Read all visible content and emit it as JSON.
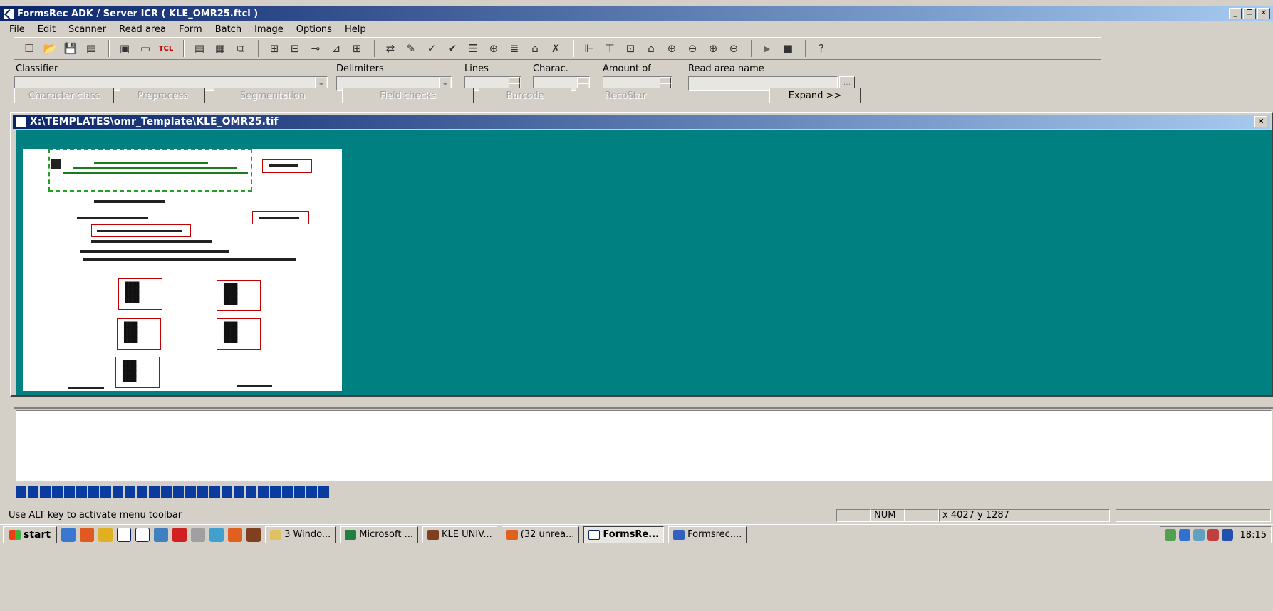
{
  "window": {
    "title": "FormsRec ADK / Server ICR ( KLE_OMR25.ftcl )",
    "min": "_",
    "max": "❐",
    "close": "✕"
  },
  "menu": [
    "File",
    "Edit",
    "Scanner",
    "Read area",
    "Form",
    "Batch",
    "Image",
    "Options",
    "Help"
  ],
  "toolbar": {
    "tcl_label": "TCL"
  },
  "params": {
    "classifier_label": "Classifier",
    "delimiters_label": "Delimiters",
    "lines_label": "Lines",
    "charac_label": "Charac.",
    "amount_label": "Amount of",
    "readarea_label": "Read area name",
    "ellipsis": "...",
    "buttons": [
      "Character class",
      "Preprocess",
      "Segmentation",
      "Field checks",
      "Barcode",
      "RecoStar"
    ],
    "expand_label": "Expand >>"
  },
  "image_window": {
    "title": "X:\\TEMPLATES\\omr_Template\\KLE_OMR25.tif",
    "close": "✕"
  },
  "progress": {
    "blocks": 26
  },
  "status": {
    "hint": "Use ALT key to activate menu toolbar",
    "num": "NUM",
    "coords": "x 4027 y 1287"
  },
  "taskbar": {
    "start": "start",
    "tasks": [
      "3 Windo...",
      "Microsoft ...",
      "KLE UNIV...",
      "(32 unrea...",
      "FormsRe...",
      "Formsrec...."
    ],
    "clock": "18:15"
  }
}
